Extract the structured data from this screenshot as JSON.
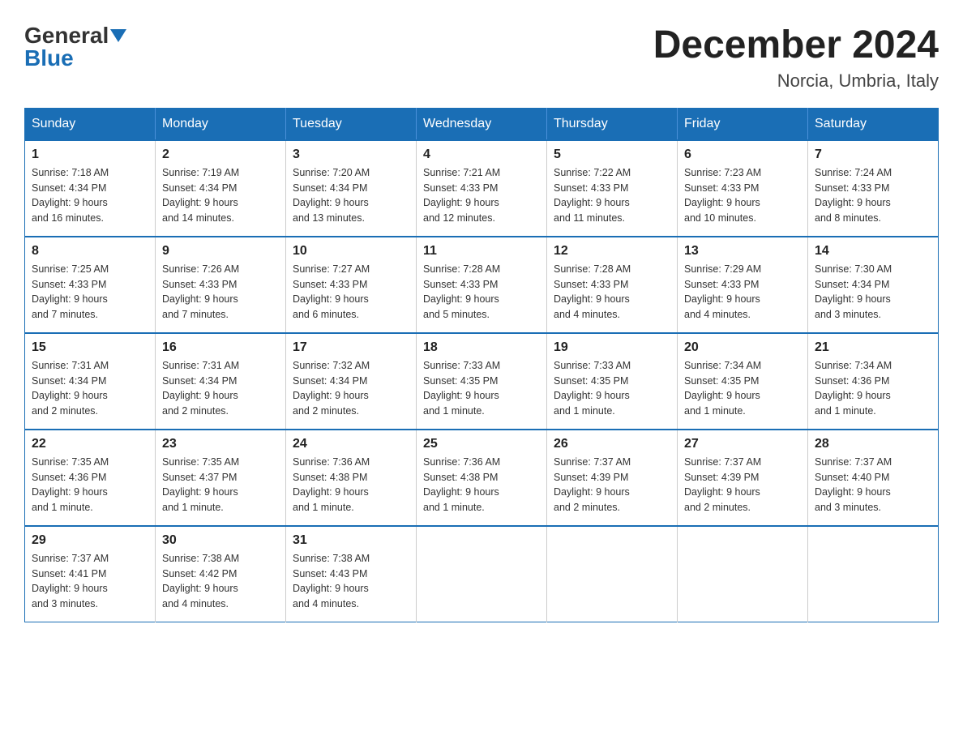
{
  "logo": {
    "general": "General",
    "blue": "Blue"
  },
  "title": {
    "month_year": "December 2024",
    "location": "Norcia, Umbria, Italy"
  },
  "days_of_week": [
    "Sunday",
    "Monday",
    "Tuesday",
    "Wednesday",
    "Thursday",
    "Friday",
    "Saturday"
  ],
  "weeks": [
    [
      {
        "day": "1",
        "sunrise": "7:18 AM",
        "sunset": "4:34 PM",
        "daylight": "9 hours and 16 minutes."
      },
      {
        "day": "2",
        "sunrise": "7:19 AM",
        "sunset": "4:34 PM",
        "daylight": "9 hours and 14 minutes."
      },
      {
        "day": "3",
        "sunrise": "7:20 AM",
        "sunset": "4:34 PM",
        "daylight": "9 hours and 13 minutes."
      },
      {
        "day": "4",
        "sunrise": "7:21 AM",
        "sunset": "4:33 PM",
        "daylight": "9 hours and 12 minutes."
      },
      {
        "day": "5",
        "sunrise": "7:22 AM",
        "sunset": "4:33 PM",
        "daylight": "9 hours and 11 minutes."
      },
      {
        "day": "6",
        "sunrise": "7:23 AM",
        "sunset": "4:33 PM",
        "daylight": "9 hours and 10 minutes."
      },
      {
        "day": "7",
        "sunrise": "7:24 AM",
        "sunset": "4:33 PM",
        "daylight": "9 hours and 8 minutes."
      }
    ],
    [
      {
        "day": "8",
        "sunrise": "7:25 AM",
        "sunset": "4:33 PM",
        "daylight": "9 hours and 7 minutes."
      },
      {
        "day": "9",
        "sunrise": "7:26 AM",
        "sunset": "4:33 PM",
        "daylight": "9 hours and 7 minutes."
      },
      {
        "day": "10",
        "sunrise": "7:27 AM",
        "sunset": "4:33 PM",
        "daylight": "9 hours and 6 minutes."
      },
      {
        "day": "11",
        "sunrise": "7:28 AM",
        "sunset": "4:33 PM",
        "daylight": "9 hours and 5 minutes."
      },
      {
        "day": "12",
        "sunrise": "7:28 AM",
        "sunset": "4:33 PM",
        "daylight": "9 hours and 4 minutes."
      },
      {
        "day": "13",
        "sunrise": "7:29 AM",
        "sunset": "4:33 PM",
        "daylight": "9 hours and 4 minutes."
      },
      {
        "day": "14",
        "sunrise": "7:30 AM",
        "sunset": "4:34 PM",
        "daylight": "9 hours and 3 minutes."
      }
    ],
    [
      {
        "day": "15",
        "sunrise": "7:31 AM",
        "sunset": "4:34 PM",
        "daylight": "9 hours and 2 minutes."
      },
      {
        "day": "16",
        "sunrise": "7:31 AM",
        "sunset": "4:34 PM",
        "daylight": "9 hours and 2 minutes."
      },
      {
        "day": "17",
        "sunrise": "7:32 AM",
        "sunset": "4:34 PM",
        "daylight": "9 hours and 2 minutes."
      },
      {
        "day": "18",
        "sunrise": "7:33 AM",
        "sunset": "4:35 PM",
        "daylight": "9 hours and 1 minute."
      },
      {
        "day": "19",
        "sunrise": "7:33 AM",
        "sunset": "4:35 PM",
        "daylight": "9 hours and 1 minute."
      },
      {
        "day": "20",
        "sunrise": "7:34 AM",
        "sunset": "4:35 PM",
        "daylight": "9 hours and 1 minute."
      },
      {
        "day": "21",
        "sunrise": "7:34 AM",
        "sunset": "4:36 PM",
        "daylight": "9 hours and 1 minute."
      }
    ],
    [
      {
        "day": "22",
        "sunrise": "7:35 AM",
        "sunset": "4:36 PM",
        "daylight": "9 hours and 1 minute."
      },
      {
        "day": "23",
        "sunrise": "7:35 AM",
        "sunset": "4:37 PM",
        "daylight": "9 hours and 1 minute."
      },
      {
        "day": "24",
        "sunrise": "7:36 AM",
        "sunset": "4:38 PM",
        "daylight": "9 hours and 1 minute."
      },
      {
        "day": "25",
        "sunrise": "7:36 AM",
        "sunset": "4:38 PM",
        "daylight": "9 hours and 1 minute."
      },
      {
        "day": "26",
        "sunrise": "7:37 AM",
        "sunset": "4:39 PM",
        "daylight": "9 hours and 2 minutes."
      },
      {
        "day": "27",
        "sunrise": "7:37 AM",
        "sunset": "4:39 PM",
        "daylight": "9 hours and 2 minutes."
      },
      {
        "day": "28",
        "sunrise": "7:37 AM",
        "sunset": "4:40 PM",
        "daylight": "9 hours and 3 minutes."
      }
    ],
    [
      {
        "day": "29",
        "sunrise": "7:37 AM",
        "sunset": "4:41 PM",
        "daylight": "9 hours and 3 minutes."
      },
      {
        "day": "30",
        "sunrise": "7:38 AM",
        "sunset": "4:42 PM",
        "daylight": "9 hours and 4 minutes."
      },
      {
        "day": "31",
        "sunrise": "7:38 AM",
        "sunset": "4:43 PM",
        "daylight": "9 hours and 4 minutes."
      },
      null,
      null,
      null,
      null
    ]
  ],
  "labels": {
    "sunrise": "Sunrise:",
    "sunset": "Sunset:",
    "daylight": "Daylight:"
  }
}
